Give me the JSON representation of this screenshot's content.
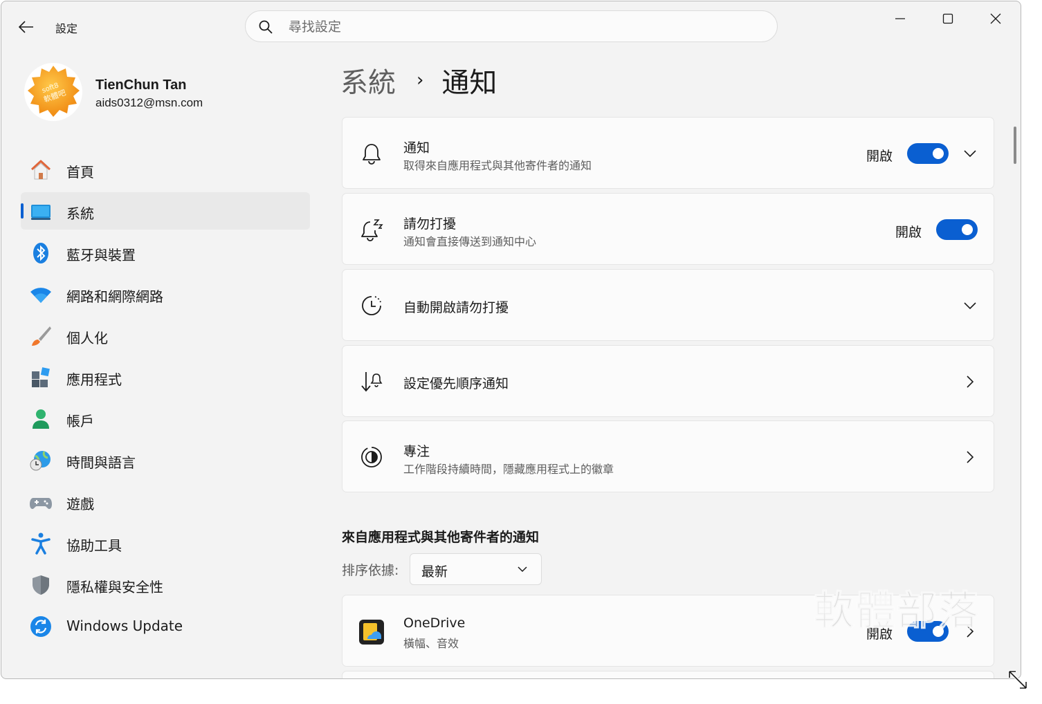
{
  "titlebar": {
    "app_title": "設定",
    "search_placeholder": "尋找設定"
  },
  "profile": {
    "name": "TienChun Tan",
    "email": "aids0312@msn.com",
    "avatar_text_line1": "soft8",
    "avatar_text_line2": "軟體吧"
  },
  "nav": {
    "items": [
      {
        "label": "首頁",
        "icon": "home-icon"
      },
      {
        "label": "系統",
        "icon": "system-icon",
        "active": true
      },
      {
        "label": "藍牙與裝置",
        "icon": "bluetooth-icon"
      },
      {
        "label": "網路和網際網路",
        "icon": "wifi-icon"
      },
      {
        "label": "個人化",
        "icon": "brush-icon"
      },
      {
        "label": "應用程式",
        "icon": "apps-icon"
      },
      {
        "label": "帳戶",
        "icon": "account-icon"
      },
      {
        "label": "時間與語言",
        "icon": "globe-clock-icon"
      },
      {
        "label": "遊戲",
        "icon": "gamepad-icon"
      },
      {
        "label": "協助工具",
        "icon": "accessibility-icon"
      },
      {
        "label": "隱私權與安全性",
        "icon": "shield-icon"
      },
      {
        "label": "Windows Update",
        "icon": "update-icon"
      }
    ]
  },
  "breadcrumb": {
    "parent": "系統",
    "separator": "›",
    "current": "通知"
  },
  "cards": {
    "notifications": {
      "title": "通知",
      "subtitle": "取得來自應用程式與其他寄件者的通知",
      "state": "開啟",
      "on": true
    },
    "dnd": {
      "title": "請勿打擾",
      "subtitle": "通知會直接傳送到通知中心",
      "state": "開啟",
      "on": true
    },
    "auto_dnd": {
      "title": "自動開啟請勿打擾"
    },
    "priority": {
      "title": "設定優先順序通知"
    },
    "focus": {
      "title": "專注",
      "subtitle": "工作階段持續時間，隱藏應用程式上的徽章"
    }
  },
  "senders": {
    "section_title": "來自應用程式與其他寄件者的通知",
    "sort_label": "排序依據:",
    "sort_value": "最新",
    "apps": [
      {
        "name": "OneDrive",
        "subtitle": "橫幅、音效",
        "state": "開啟",
        "on": true
      }
    ]
  },
  "watermark": "軟體部落",
  "colors": {
    "accent": "#0a5fd1",
    "window_bg": "#f3f3f3",
    "card_bg": "#fbfbfb"
  }
}
